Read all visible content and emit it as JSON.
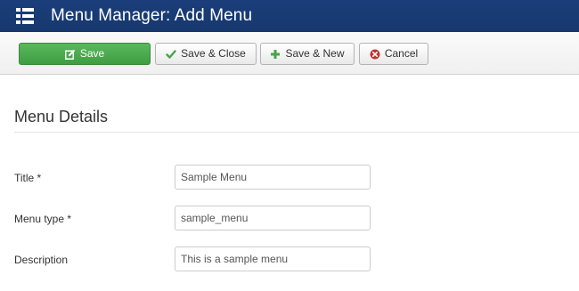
{
  "header": {
    "title": "Menu Manager: Add Menu",
    "icon": "list-menu-icon"
  },
  "toolbar": {
    "save_label": "Save",
    "save_close_label": "Save & Close",
    "save_new_label": "Save & New",
    "cancel_label": "Cancel"
  },
  "section": {
    "title": "Menu Details"
  },
  "form": {
    "title": {
      "label": "Title *",
      "value": "Sample Menu"
    },
    "menu_type": {
      "label": "Menu type *",
      "value": "sample_menu"
    },
    "description": {
      "label": "Description",
      "value": "This is a sample menu"
    }
  },
  "colors": {
    "header_bg": "#17386e",
    "save_green": "#46a546",
    "cancel_red": "#bd362f"
  }
}
